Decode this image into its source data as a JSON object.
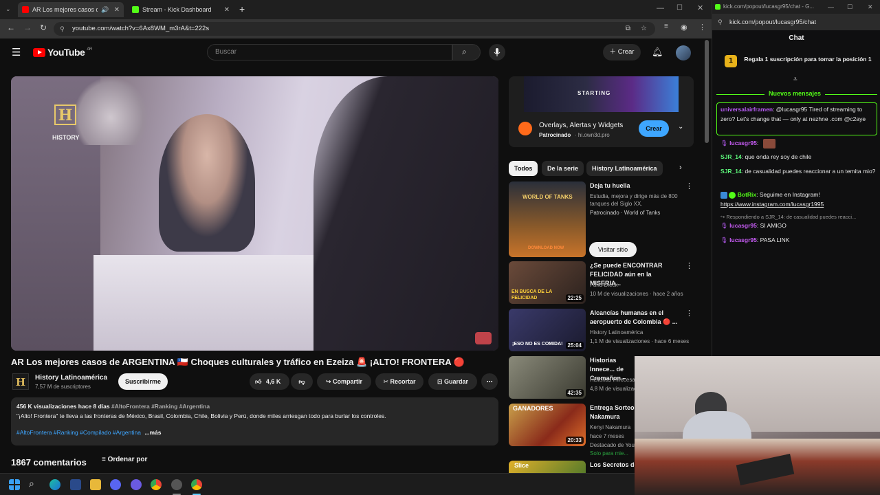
{
  "browser": {
    "tabs": [
      {
        "label": "AR Los mejores casos de AR"
      },
      {
        "label": "Stream - Kick Dashboard"
      }
    ],
    "url": "youtube.com/watch?v=6Ax8WM_m3rA&t=222s"
  },
  "youtube": {
    "logo_text": "YouTube",
    "country": "AR",
    "search_placeholder": "Buscar",
    "create_label": "Crear",
    "video": {
      "watermark_brand": "HISTORY",
      "title": "AR Los mejores casos de ARGENTINA 🇨🇱 Choques culturales y tráfico en Ezeiza 🚨 ¡ALTO! FRONTERA 🔴",
      "channel": "History Latinoamérica",
      "subscribers": "7,57 M de suscriptores",
      "subscribe_label": "Suscribirme",
      "likes": "4,6 K",
      "share_label": "Compartir",
      "clip_label": "Recortar",
      "save_label": "Guardar",
      "views_date": "456 K visualizaciones  hace 8 días",
      "desc_tags_top": "#AltoFrontera #Ranking #Argentina",
      "description": "\"¡Alto! Frontera\" te lleva a las fronteras de México, Brasil, Colombia, Chile, Bolivia y Perú, donde miles arriesgan todo para burlar los controles.",
      "desc_tags_bottom": "#AltoFrontera #Ranking #Compilado #Argentina",
      "more_label": "...más",
      "comments_count": "1867 comentarios",
      "sort_label": "Ordenar por"
    },
    "ad": {
      "title": "Overlays, Alertas y Widgets",
      "sponsor": "Patrocinado",
      "domain": "hi.own3d.pro",
      "cta": "Crear",
      "banner_text": "STARTING"
    },
    "chips": [
      "Todos",
      "De la serie",
      "History Latinoamérica"
    ],
    "sidebar": [
      {
        "title": "Deja tu huella",
        "line2": "Estudia, mejora y dirige más de 800 tanques del Siglo XX.",
        "line3": "Patrocinado · World of Tanks",
        "cta": "Visitar sitio",
        "thumb_text": "WORLD OF TANKS",
        "thumb_sub": "DOWNLOAD NOW"
      },
      {
        "title": "¿Se puede ENCONTRAR FELICIDAD aún en la MISERIA...",
        "channel": "Farid Dieck",
        "meta": "10 M de visualizaciones · hace 2 años",
        "duration": "22:25",
        "thumb_text": "EN BUSCA DE LA FELICIDAD"
      },
      {
        "title": "Alcancías humanas en el aeropuerto de Colombia 🔴 ...",
        "channel": "History Latinoamérica",
        "meta": "1,1 M de visualizaciones · hace 6 meses",
        "duration": "25:04",
        "thumb_text": "¡ESO NO ES COMIDA!"
      },
      {
        "title": "Historias Innece... de Cromañon –",
        "channel": "Historias Innecesa...",
        "meta": "4,8 M de visualizac...",
        "duration": "42:35"
      },
      {
        "title": "Entrega Sorteo Nakamura",
        "channel": "Kenyi Nakamura",
        "meta": "hace 7 meses",
        "extra": "Destacado de You...",
        "extra2": "Solo para mie...",
        "duration": "20:33",
        "thumb_text": "GANADORES"
      },
      {
        "title": "Los Secretos de",
        "thumb_text": "Slice"
      }
    ]
  },
  "chat": {
    "tab_title": "kick.com/popout/lucasgr95/chat - G...",
    "url": "kick.com/popout/lucasgr95/chat",
    "header": "Chat",
    "pinned": "Regala 1 suscripción para tomar la posición 1",
    "new_messages": "Nuevos mensajes",
    "messages": [
      {
        "user": "universalairframen",
        "text": ": @lucasgr95 Tired of streaming to zero? Let's change that — only at nezhne .com @c2aye"
      },
      {
        "user": "lucasgr95",
        "text": ":"
      },
      {
        "user": "SJR_14",
        "text": ": que onda rey soy de chile"
      },
      {
        "user": "SJR_14",
        "text": ": de casualidad puedes reaccionar a un temita mio?"
      },
      {
        "user": "BotRix",
        "text": ": Seguime en Instagram!"
      },
      {
        "user": "",
        "text": "https://www.instagram.com/lucasgr1995"
      },
      {
        "user": "",
        "text": "Respondiendo a SJR_14: de casualidad puedes reacci..."
      },
      {
        "user": "lucasgr95",
        "text": ": SI AMIGO"
      },
      {
        "user": "lucasgr95",
        "text": ": PASA LINK"
      }
    ]
  },
  "colors": {
    "yt_red": "#ff0000",
    "kick_green": "#53fc18",
    "link_blue": "#3ea6ff"
  }
}
